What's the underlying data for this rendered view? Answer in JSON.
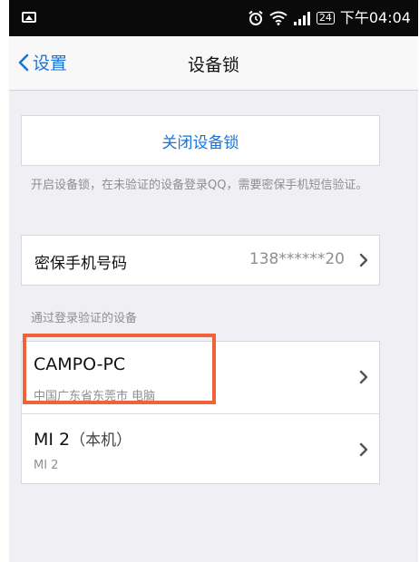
{
  "status_bar": {
    "left_icon": "image-icon",
    "alarm_icon": "alarm-clock-icon",
    "wifi_icon": "wifi-icon",
    "signal_icon": "signal-bars-icon",
    "battery": "24",
    "time": "下午04:04"
  },
  "nav": {
    "back_label": "设置",
    "title": "设备锁"
  },
  "main": {
    "close_lock_button": "关闭设备锁",
    "description": "开启设备锁，在未验证的设备登录QQ，需要密保手机短信验证。",
    "phone_row": {
      "label": "密保手机号码",
      "value": "138******20"
    },
    "devices_section_label": "通过登录验证的设备",
    "devices": [
      {
        "name": "CAMPO-PC",
        "suffix": "",
        "detail": "中国广东省东莞市 电脑"
      },
      {
        "name": "MI 2",
        "suffix": "（本机）",
        "detail": "MI 2"
      }
    ]
  },
  "colors": {
    "accent": "#1a73d9",
    "highlight": "#f0623a",
    "background": "#efeff4"
  }
}
